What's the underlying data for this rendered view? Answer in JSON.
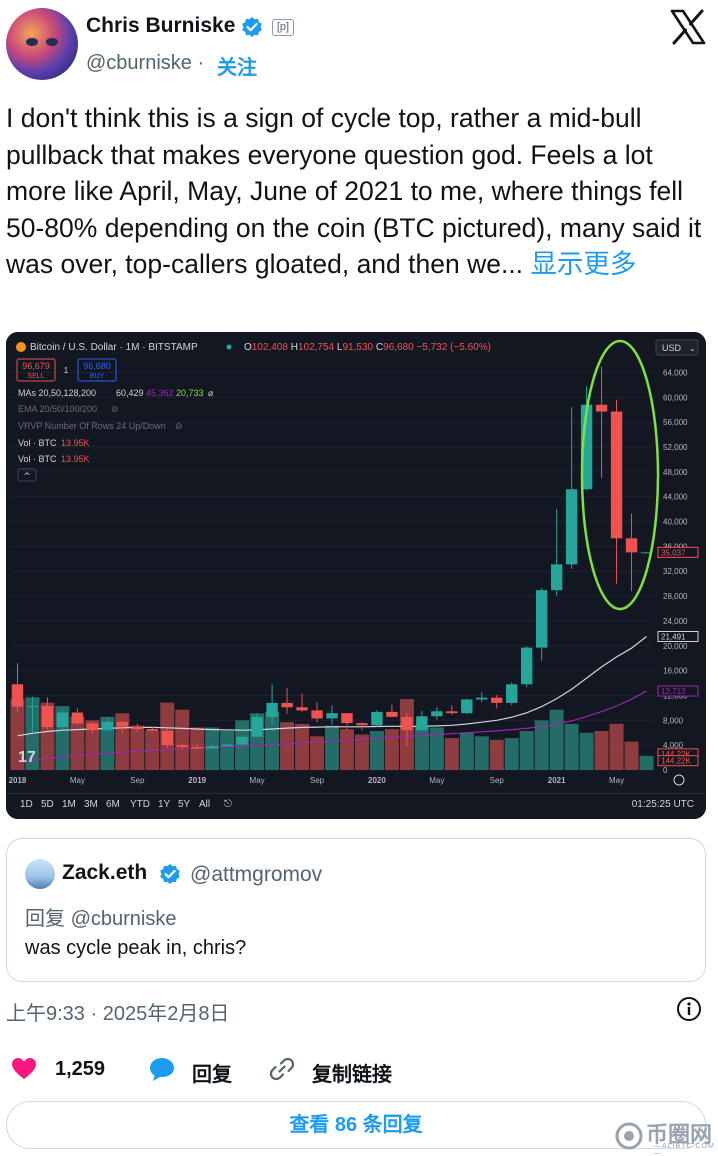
{
  "author": {
    "name": "Chris Burniske",
    "handle": "@cburniske",
    "separator": "·",
    "follow_label": "关注",
    "label_badge": "[p]",
    "accent_color": "#1d9bf0"
  },
  "tweet": {
    "text": "I don't think this is a sign of cycle top, rather a mid-bull pullback that makes everyone question god. Feels a lot more like April, May, June of 2021 to me, where things fell 50-80% depending on the coin (BTC pictured), many said it was over, top-callers gloated, and then we...",
    "show_more": "显示更多",
    "timestamp": "上午9:33 · 2025年2月8日"
  },
  "chart": {
    "header": {
      "symbol": "Bitcoin / U.S. Dollar · 1M · BITSTAMP",
      "ohlc": [
        {
          "k": "O",
          "v": "102,408"
        },
        {
          "k": "H",
          "v": "102,754"
        },
        {
          "k": "L",
          "v": "91,530"
        },
        {
          "k": "C",
          "v": "96,680"
        }
      ],
      "change": "−5,732 (−5.60%)",
      "sell_price": "96,679",
      "sell_label": "SELL",
      "spread": "1",
      "buy_price": "96,680",
      "buy_label": "BUY",
      "currency": "USD"
    },
    "indicators": {
      "mas_label": "MAs 20,50,128,200",
      "mas_values": [
        "60,429",
        "45,362",
        "20,733",
        "⌀"
      ],
      "ema_label": "EMA 20/50/100/200",
      "vrvp_label": "VRVP Number Of Rows 24 Up/Down",
      "vol1_label": "Vol · BTC",
      "vol1_value": "13.95K",
      "vol2_label": "Vol · BTC",
      "vol2_value": "13.95K"
    },
    "y_ticks": [
      "64,000",
      "60,000",
      "56,000",
      "52,000",
      "48,000",
      "44,000",
      "40,000",
      "36,000",
      "32,000",
      "28,000",
      "24,000",
      "20,000",
      "16,000",
      "12,000",
      "8,000",
      "4,000",
      "0"
    ],
    "price_tags": [
      {
        "label": "35,037",
        "color": "#ef5350"
      },
      {
        "label": "21,491",
        "color": "#d1d4dc"
      },
      {
        "label": "12,713",
        "color": "#9c27b0"
      },
      {
        "label": "144.22K",
        "color": "#ef5350"
      },
      {
        "label": "144.22K",
        "color": "#ef5350"
      }
    ],
    "x_ticks": [
      "2018",
      "May",
      "Sep",
      "2019",
      "May",
      "Sep",
      "2020",
      "May",
      "Sep",
      "2021",
      "May"
    ],
    "range_buttons": [
      "1D",
      "5D",
      "1M",
      "3M",
      "6M",
      "YTD",
      "1Y",
      "5Y",
      "All"
    ],
    "clock": "01:25:25 UTC",
    "tv_logo": "17",
    "highlight_color": "#7fe03f"
  },
  "chart_data": {
    "type": "candlestick",
    "title": "Bitcoin / U.S. Dollar · 1M · BITSTAMP",
    "xlabel": "",
    "ylabel": "",
    "ylim": [
      0,
      66000
    ],
    "grid": true,
    "months": [
      "2018-01",
      "2018-02",
      "2018-03",
      "2018-04",
      "2018-05",
      "2018-06",
      "2018-07",
      "2018-08",
      "2018-09",
      "2018-10",
      "2018-11",
      "2018-12",
      "2019-01",
      "2019-02",
      "2019-03",
      "2019-04",
      "2019-05",
      "2019-06",
      "2019-07",
      "2019-08",
      "2019-09",
      "2019-10",
      "2019-11",
      "2019-12",
      "2020-01",
      "2020-02",
      "2020-03",
      "2020-04",
      "2020-05",
      "2020-06",
      "2020-07",
      "2020-08",
      "2020-09",
      "2020-10",
      "2020-11",
      "2020-12",
      "2021-01",
      "2021-02",
      "2021-03",
      "2021-04",
      "2021-05",
      "2021-06",
      "2021-07"
    ],
    "candles": [
      {
        "o": 13800,
        "h": 17200,
        "l": 9400,
        "c": 10200
      },
      {
        "o": 10200,
        "h": 11800,
        "l": 6000,
        "c": 10300
      },
      {
        "o": 10300,
        "h": 11700,
        "l": 6500,
        "c": 6900
      },
      {
        "o": 6900,
        "h": 9800,
        "l": 6500,
        "c": 9250
      },
      {
        "o": 9250,
        "h": 9950,
        "l": 7200,
        "c": 7500
      },
      {
        "o": 7500,
        "h": 7800,
        "l": 5800,
        "c": 6400
      },
      {
        "o": 6400,
        "h": 8500,
        "l": 6200,
        "c": 7750
      },
      {
        "o": 7750,
        "h": 7800,
        "l": 5900,
        "c": 7000
      },
      {
        "o": 7000,
        "h": 7400,
        "l": 6100,
        "c": 6600
      },
      {
        "o": 6600,
        "h": 7000,
        "l": 6200,
        "c": 6300
      },
      {
        "o": 6300,
        "h": 6600,
        "l": 3600,
        "c": 4000
      },
      {
        "o": 4000,
        "h": 4300,
        "l": 3200,
        "c": 3700
      },
      {
        "o": 3700,
        "h": 4100,
        "l": 3400,
        "c": 3450
      },
      {
        "o": 3450,
        "h": 4200,
        "l": 3400,
        "c": 3850
      },
      {
        "o": 3850,
        "h": 4100,
        "l": 3700,
        "c": 4100
      },
      {
        "o": 4100,
        "h": 5600,
        "l": 4000,
        "c": 5350
      },
      {
        "o": 5350,
        "h": 9100,
        "l": 5300,
        "c": 8550
      },
      {
        "o": 8550,
        "h": 13800,
        "l": 7400,
        "c": 10800
      },
      {
        "o": 10800,
        "h": 13200,
        "l": 9100,
        "c": 10100
      },
      {
        "o": 10100,
        "h": 12300,
        "l": 9400,
        "c": 9600
      },
      {
        "o": 9600,
        "h": 10900,
        "l": 7700,
        "c": 8300
      },
      {
        "o": 8300,
        "h": 10400,
        "l": 7300,
        "c": 9150
      },
      {
        "o": 9150,
        "h": 9200,
        "l": 6500,
        "c": 7550
      },
      {
        "o": 7550,
        "h": 7700,
        "l": 6400,
        "c": 7200
      },
      {
        "o": 7200,
        "h": 9600,
        "l": 6900,
        "c": 9350
      },
      {
        "o": 9350,
        "h": 10500,
        "l": 8500,
        "c": 8550
      },
      {
        "o": 8550,
        "h": 9200,
        "l": 3800,
        "c": 6400
      },
      {
        "o": 6400,
        "h": 9500,
        "l": 6200,
        "c": 8650
      },
      {
        "o": 8650,
        "h": 10100,
        "l": 8100,
        "c": 9450
      },
      {
        "o": 9450,
        "h": 10400,
        "l": 8900,
        "c": 9150
      },
      {
        "o": 9150,
        "h": 11500,
        "l": 9000,
        "c": 11350
      },
      {
        "o": 11350,
        "h": 12500,
        "l": 10900,
        "c": 11650
      },
      {
        "o": 11650,
        "h": 12100,
        "l": 9900,
        "c": 10800
      },
      {
        "o": 10800,
        "h": 14100,
        "l": 10400,
        "c": 13800
      },
      {
        "o": 13800,
        "h": 19900,
        "l": 13300,
        "c": 19700
      },
      {
        "o": 19700,
        "h": 29300,
        "l": 17600,
        "c": 28950
      },
      {
        "o": 28950,
        "h": 42000,
        "l": 28100,
        "c": 33100
      },
      {
        "o": 33100,
        "h": 58400,
        "l": 32400,
        "c": 45200
      },
      {
        "o": 45200,
        "h": 61800,
        "l": 45000,
        "c": 58800
      },
      {
        "o": 58800,
        "h": 64900,
        "l": 47000,
        "c": 57700
      },
      {
        "o": 57700,
        "h": 59600,
        "l": 30000,
        "c": 37300
      },
      {
        "o": 37300,
        "h": 41300,
        "l": 28800,
        "c": 35037
      },
      {
        "o": 35037,
        "h": 35100,
        "l": 35000,
        "c": 35037
      }
    ],
    "volume": [
      200,
      205,
      190,
      180,
      150,
      140,
      150,
      160,
      125,
      110,
      190,
      170,
      120,
      120,
      110,
      140,
      160,
      165,
      135,
      130,
      95,
      125,
      115,
      100,
      110,
      115,
      200,
      125,
      120,
      90,
      105,
      95,
      85,
      90,
      110,
      140,
      170,
      130,
      105,
      110,
      130,
      80,
      40
    ],
    "ma_white": [
      5500,
      5900,
      6200,
      6400,
      6500,
      6600,
      6700,
      6800,
      6850,
      6850,
      6800,
      6700,
      6600,
      6500,
      6450,
      6400,
      6450,
      6600,
      6750,
      6850,
      6900,
      6950,
      6950,
      6950,
      7000,
      7050,
      7000,
      7050,
      7100,
      7200,
      7400,
      7700,
      8000,
      8500,
      9200,
      10200,
      11500,
      13000,
      14800,
      16600,
      18200,
      19600,
      21491
    ],
    "ma_purple": [
      1500,
      1700,
      1900,
      2100,
      2300,
      2500,
      2700,
      2850,
      3000,
      3150,
      3300,
      3450,
      3550,
      3650,
      3750,
      3850,
      3950,
      4050,
      4200,
      4350,
      4500,
      4650,
      4800,
      4950,
      5100,
      5250,
      5400,
      5550,
      5700,
      5850,
      6000,
      6150,
      6300,
      6500,
      6700,
      7000,
      7400,
      7900,
      8600,
      9400,
      10300,
      11400,
      12713
    ]
  },
  "quote": {
    "name": "Zack.eth",
    "handle": "@attmgromov",
    "reply_to_label": "回复",
    "reply_to_handle": "@cburniske",
    "text": "was cycle peak in, chris?"
  },
  "actions": {
    "likes": "1,259",
    "reply_label": "回复",
    "copy_link_label": "复制链接",
    "like_color": "#f91880"
  },
  "replies_button": "查看 86 条回复",
  "watermark": {
    "text": "币圈网",
    "sub": "—ALIBTC.COM—"
  }
}
